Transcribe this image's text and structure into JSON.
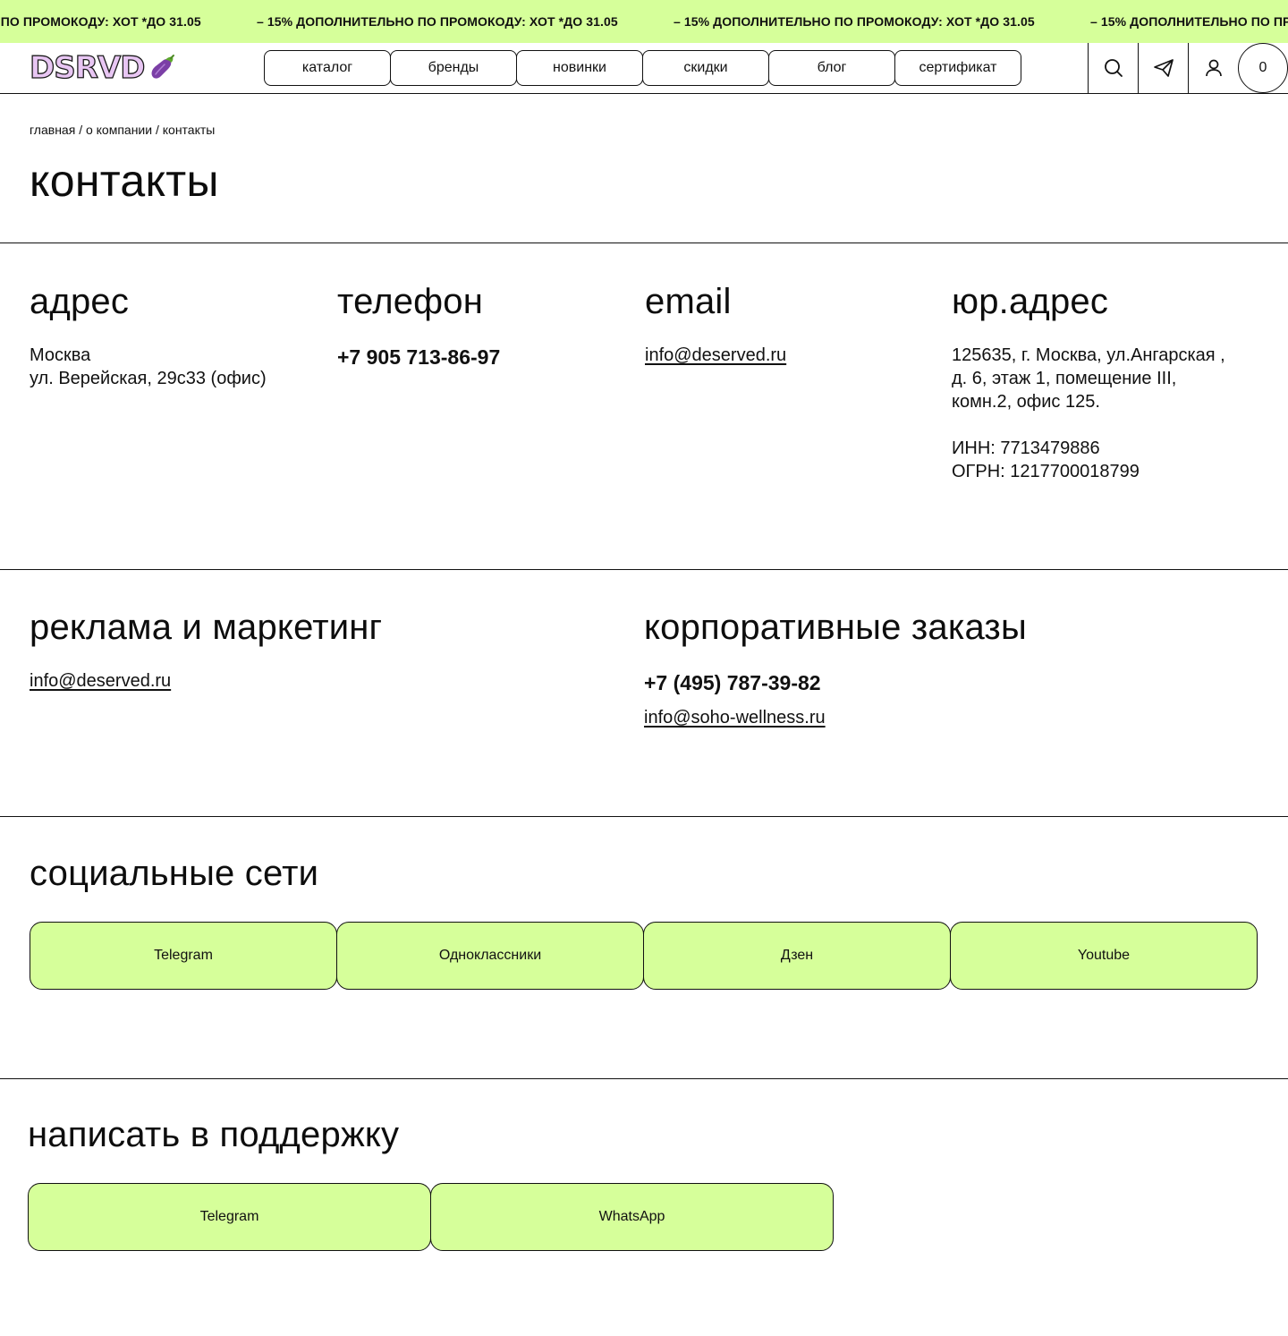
{
  "promo": {
    "text": "– 15% ДОПОЛНИТЕЛЬНО ПО ПРОМОКОДУ: ХОТ *ДО 31.05"
  },
  "header": {
    "logo_text": "DSRVD",
    "nav": [
      "каталог",
      "бренды",
      "новинки",
      "скидки",
      "блог",
      "сертификат"
    ],
    "cart_count": "0"
  },
  "breadcrumb": {
    "items": [
      "главная",
      "о компании",
      "контакты"
    ],
    "separator": "/"
  },
  "page": {
    "title": "контакты"
  },
  "contacts": {
    "address": {
      "title": "адрес",
      "lines": [
        "Москва",
        "ул. Верейская, 29с33 (офис)"
      ]
    },
    "phone": {
      "title": "телефон",
      "value": "+7 905 713-86-97"
    },
    "email": {
      "title": "email",
      "value": "info@deserved.ru"
    },
    "legal": {
      "title": "юр.адрес",
      "lines": [
        "125635, г. Москва, ул.Ангарская ,",
        "д. 6, этаж 1, помещение III,",
        "комн.2, офис 125."
      ],
      "inn": "ИНН: 7713479886",
      "ogrn": "ОГРН: 1217700018799"
    }
  },
  "marketing": {
    "title": "реклама и маркетинг",
    "email": "info@deserved.ru"
  },
  "corporate": {
    "title": "корпоративные заказы",
    "phone": "+7 (495) 787-39-82",
    "email": "info@soho-wellness.ru"
  },
  "social": {
    "title": "социальные сети",
    "buttons": [
      "Telegram",
      "Одноклассники",
      "Дзен",
      "Youtube"
    ]
  },
  "support": {
    "title": "написать в поддержку",
    "buttons": [
      "Telegram",
      "WhatsApp"
    ]
  },
  "colors": {
    "accent_green": "#d6ff9a",
    "logo_lilac": "#e8c6f3"
  }
}
